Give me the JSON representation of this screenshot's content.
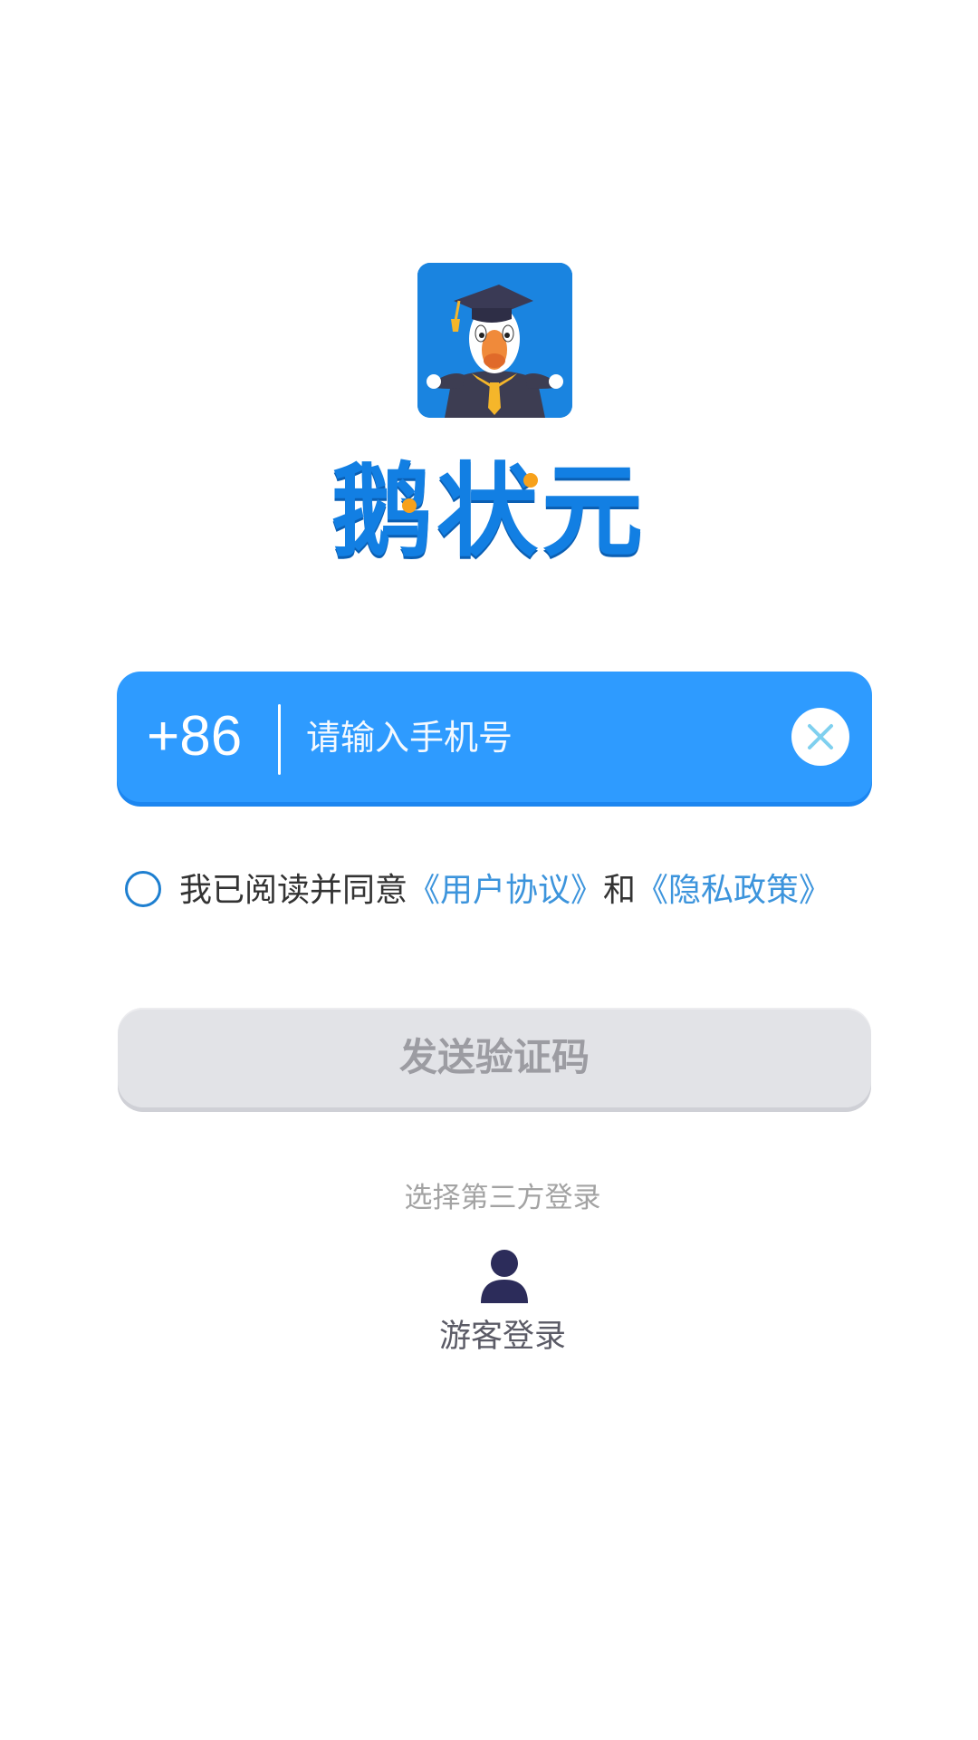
{
  "app": {
    "logo_icon": "goose-graduate-logo",
    "wordmark": "鹅状元"
  },
  "phone": {
    "country_code": "+86",
    "placeholder": "请输入手机号",
    "value": "",
    "clear_icon": "close-icon"
  },
  "agreement": {
    "checked": false,
    "prefix": "我已阅读并同意",
    "user_agreement_link": "《用户协议》",
    "conjunction": "和",
    "privacy_policy_link": "《隐私政策》"
  },
  "send_code": {
    "label": "发送验证码",
    "enabled": false
  },
  "third_party": {
    "title": "选择第三方登录",
    "guest": {
      "icon": "user-icon",
      "label": "游客登录"
    }
  },
  "colors": {
    "brand_blue": "#2e9bff",
    "wordmark_blue": "#127fe3",
    "link_blue": "#3c94dc",
    "disabled_button_bg": "#e2e3e7",
    "disabled_button_text": "#9c9ca2",
    "guest_icon": "#2c2c5a"
  }
}
